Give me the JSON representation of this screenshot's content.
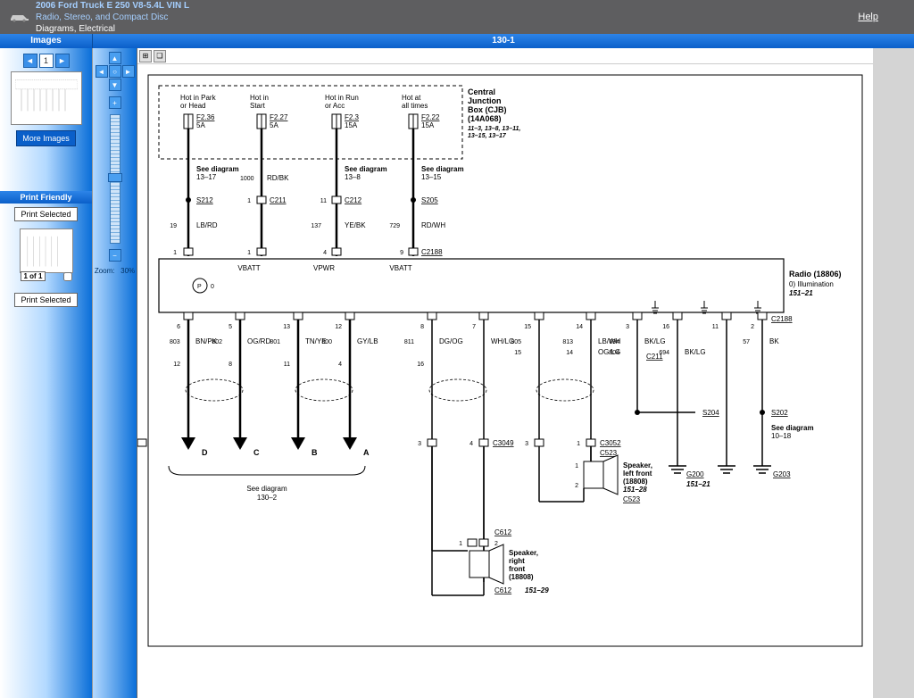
{
  "header": {
    "vehicle": "2006 Ford Truck E 250 V8-5.4L VIN L",
    "system": "Radio, Stereo, and Compact Disc",
    "crumb": "Diagrams, Electrical",
    "help": "Help"
  },
  "toolbar": {
    "images": "Images",
    "page": "130-1"
  },
  "sidebar": {
    "more_images": "More Images",
    "print_friendly": "Print Friendly",
    "print_selected": "Print Selected",
    "page_of": "1 of 1",
    "zoom_label": "Zoom:",
    "zoom_value": "30%"
  },
  "diagram": {
    "junction_box": {
      "title": "Central",
      "line2": "Junction",
      "line3": "Box (CJB)",
      "part": "(14A068)",
      "refs": "11–3, 13–8, 13–11,",
      "refs2": "13–15, 13–17"
    },
    "fuses": [
      {
        "label": "Hot in Park",
        "label2": "or Head",
        "id": "F2.36",
        "amp": "5A"
      },
      {
        "label": "Hot in",
        "label2": "Start",
        "id": "F2.27",
        "amp": "5A"
      },
      {
        "label": "Hot in Run",
        "label2": "or Acc",
        "id": "F2.3",
        "amp": "15A"
      },
      {
        "label": "Hot at",
        "label2": "all times",
        "id": "F2.22",
        "amp": "15A"
      }
    ],
    "see_diagrams": {
      "d1": "See diagram",
      "d1v": "13–17",
      "d2": "See diagram",
      "d2v": "13–8",
      "d3": "See diagram",
      "d3v": "13–15",
      "bottom": "See diagram",
      "bottomv": "130–2",
      "right": "See diagram",
      "rightv": "10–18"
    },
    "connectors": {
      "s212": "S212",
      "c211": "C211",
      "c212": "C212",
      "s205": "S205",
      "c2188": "C2188",
      "c2188b": "C2188",
      "c3049": "C3049",
      "c3052": "C3052",
      "c523": "C523",
      "c523b": "C523",
      "c612": "C612",
      "c612b": "C612",
      "c211b": "C211",
      "s204": "S204",
      "s202": "S202",
      "g200": "G200",
      "g203": "G203"
    },
    "wire_nums": {
      "n1000": "1000",
      "n19": "19",
      "n1": "1",
      "n11": "11",
      "n137": "137",
      "n729": "729",
      "n803": "803",
      "n802": "802",
      "n801": "801",
      "n800": "800",
      "n811": "811",
      "n805": "805",
      "n813": "813",
      "n804": "804",
      "n694": "694",
      "n694b": "694",
      "n57": "57",
      "n6": "6",
      "n5": "5",
      "n13": "13",
      "n12": "12",
      "n8": "8",
      "n7": "7",
      "n4l": "4",
      "n15": "15",
      "n14": "14",
      "n3a": "3",
      "n16": "16",
      "n11b": "11",
      "n2": "2",
      "n9": "9",
      "p12": "12",
      "p8": "8",
      "p11": "11",
      "p4": "4",
      "p16": "16",
      "c3": "3",
      "c4": "4",
      "c3b": "3",
      "c1": "1",
      "c1b": "1",
      "c2b": "2",
      "c2c": "2"
    },
    "wire_colors": {
      "rdbk": "RD/BK",
      "lbrd": "LB/RD",
      "yebk": "YE/BK",
      "rdwh": "RD/WH",
      "bnpk": "BN/PK",
      "ogrd": "OG/RD",
      "tnye": "TN/YE",
      "gylb": "GY/LB",
      "dgog": "DG/OG",
      "whlg": "WH/LG",
      "lbwh": "LB/WH",
      "oglg": "OG/LG",
      "bklg": "BK/LG",
      "bklg2": "BK/LG",
      "bk": "BK"
    },
    "radio": {
      "name": "Radio (18806)",
      "illum": "0) Illumination",
      "ref": "151–21",
      "vbatt1": "VBATT",
      "vpwr": "VPWR",
      "vbatt2": "VBATT",
      "psym": "0"
    },
    "speakers": {
      "lf": {
        "l1": "Speaker,",
        "l2": "left front",
        "l3": "(18808)",
        "ref": "151–28"
      },
      "rf": {
        "l1": "Speaker,",
        "l2": "right",
        "l3": "front",
        "l4": "(18808)",
        "ref": "151–29"
      }
    },
    "arrows": {
      "a": "A",
      "b": "B",
      "c": "C",
      "d": "D"
    },
    "grounds": {
      "g1": "151–21"
    }
  }
}
